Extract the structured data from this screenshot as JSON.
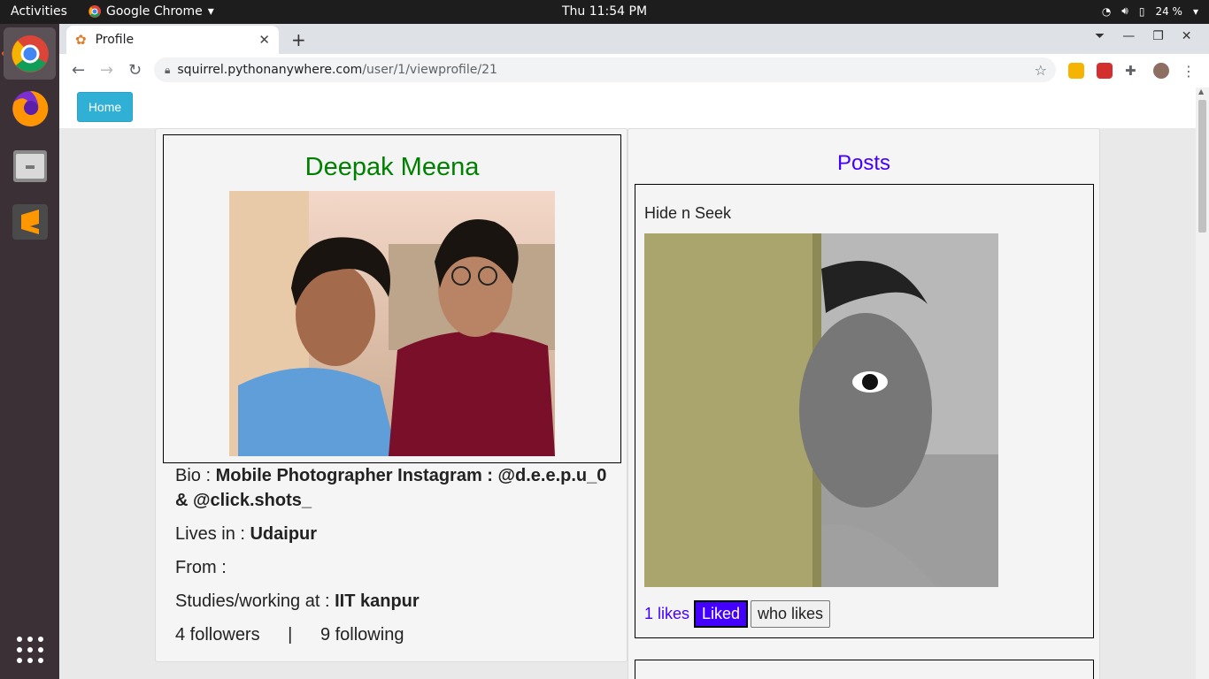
{
  "system": {
    "activities": "Activities",
    "app_name": "Google Chrome",
    "clock": "Thu 11:54 PM",
    "battery": "24 %"
  },
  "browser": {
    "tab_title": "Profile",
    "url_host": "squirrel.pythonanywhere.com",
    "url_path": "/user/1/viewprofile/21"
  },
  "nav": {
    "home_label": "Home"
  },
  "profile": {
    "name": "Deepak Meena",
    "bio_label": "Bio : ",
    "bio": "Mobile Photographer Instagram : @d.e.e.p.u_0 & @click.shots_",
    "lives_label": "Lives in : ",
    "lives_in": "Udaipur",
    "from_label": "From : ",
    "from": "",
    "studies_label": "Studies/working at : ",
    "studies": "IIT kanpur",
    "followers": "4 followers",
    "separator": "|",
    "following": "9 following"
  },
  "posts": {
    "title": "Posts",
    "items": [
      {
        "title": "Hide n Seek",
        "likes": "1 likes",
        "liked_label": "Liked",
        "who_likes_label": "who likes"
      }
    ]
  }
}
